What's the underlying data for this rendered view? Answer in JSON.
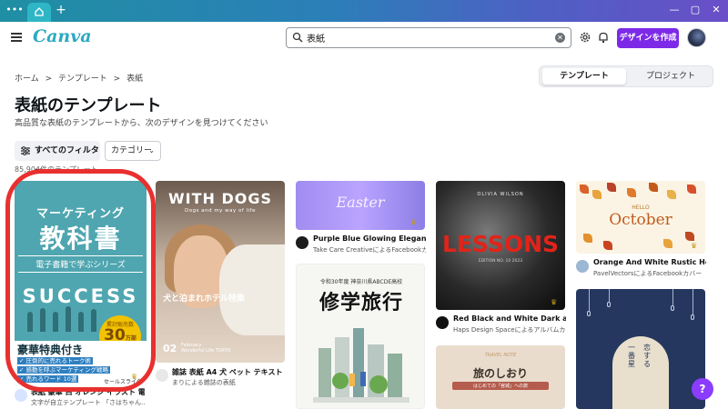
{
  "window": {
    "tab_icon": "home-icon",
    "new_tab": "+",
    "controls": [
      "—",
      "▢",
      "✕"
    ]
  },
  "nav": {
    "logo": "Canva",
    "search_value": "表紙",
    "create_button": "デザインを作成"
  },
  "breadcrumb": [
    "ホーム",
    ">",
    "テンプレート",
    ">",
    "表紙"
  ],
  "toggle": {
    "templates": "テンプレート",
    "projects": "プロジェクト"
  },
  "page": {
    "title": "表紙のテンプレート",
    "subtitle": "高品質な表紙のテンプレートから、次のデザインを見つけてください"
  },
  "filters": {
    "all_filters": "すべてのフィルター",
    "category": "カテゴリー",
    "count": "85,904件のテンプレート"
  },
  "cards": {
    "c1": {
      "line1": "マーケティング",
      "line2": "教科書",
      "line3": "電子書籍で学ぶシリーズ",
      "line4": "SUCCESS",
      "badge_top": "累計販売数",
      "badge_num": "30",
      "badge_unit": "万部",
      "badge_bottom": "突破",
      "gift": "豪華特典付き",
      "bullets": [
        "✓ 圧倒的に売れるトーク術",
        "✓ 感動を呼ぶマーケティング戦略",
        "✓ 売れるワード 10選"
      ],
      "sales": "セールスライター",
      "meta_title": "表紙 豪華 白 オレンジ イラスト 電子...",
      "meta_sub": "文字が自立テンプレート 「さはちゃん..."
    },
    "c2": {
      "heading": "WITH DOGS",
      "tagline": "Dogs and my way of life",
      "caption": "犬と泊まれホテル特集",
      "issue": "02",
      "issue_sub": "February\nWonderful Life TOKYO",
      "meta_title": "雑誌 表紙 A4 犬 ペット テキスト 白...",
      "meta_sub": "まりによる雑誌の表紙"
    },
    "c3": {
      "script": "Easter",
      "meta_title": "Purple Blue Glowing Elegant Eas...",
      "meta_sub": "Take Care CreativeによるFacebookカバ..."
    },
    "c4": {
      "top": "令和30年度 神奈川県ABCDE高校",
      "big": "修学旅行"
    },
    "c5": {
      "author": "OLIVIA WILSON",
      "title": "LESSONS",
      "edition": "EDITION NO. 10 2023",
      "meta_title": "Red Black and White Dark and G...",
      "meta_sub": "Haps Design Spaceによるアルバムカバー"
    },
    "c6": {
      "small": "TRAVEL NOTE",
      "title": "旅のしおり",
      "sub": "はじめての「宮城」への旅"
    },
    "c7": {
      "hello": "HELLO",
      "title": "October",
      "meta_title": "Orange And White Rustic Hello ...",
      "meta_sub": "PavelVectorsによるFacebookカバー"
    },
    "c8": {
      "col1": "一番星",
      "col2": "恋する"
    }
  },
  "help_label": "?"
}
